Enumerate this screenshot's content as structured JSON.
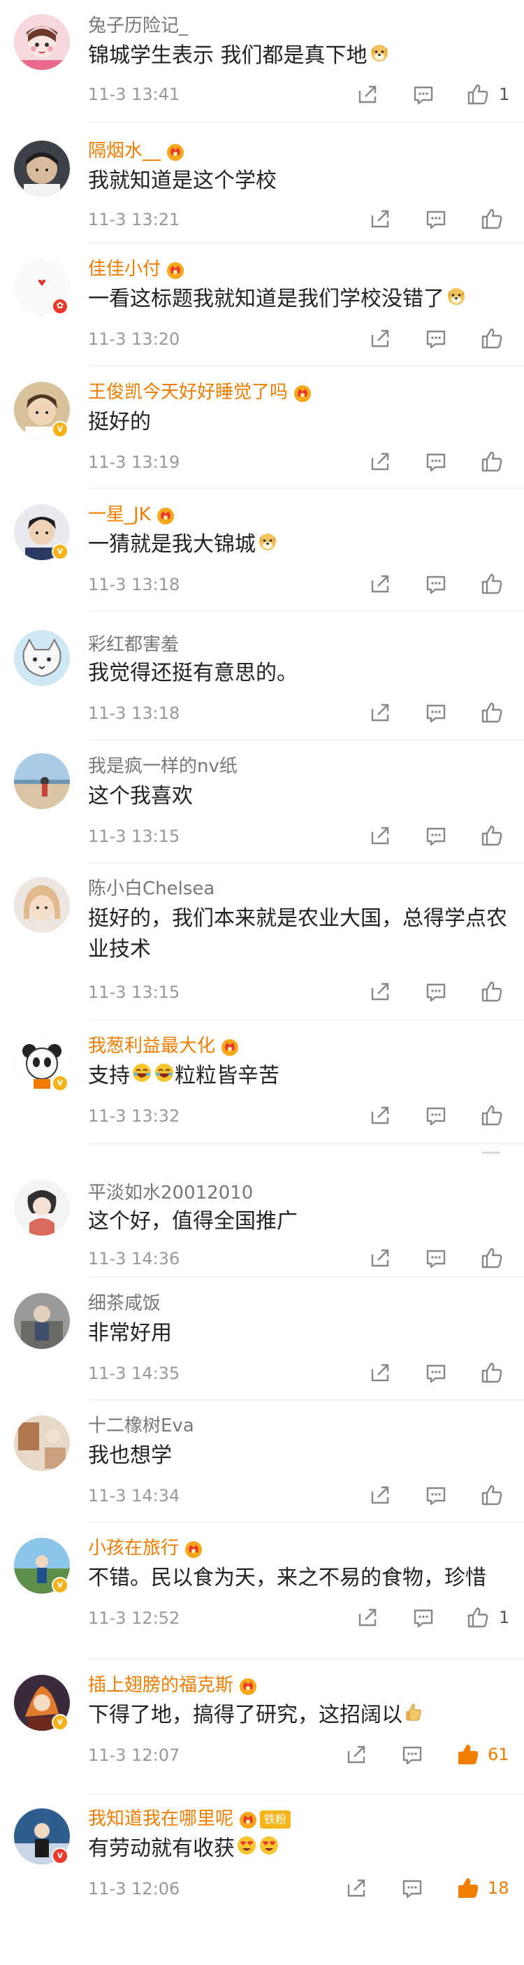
{
  "comments": [
    {
      "user": "兔子历险记_",
      "text": "锦城学生表示 我们都是真下地",
      "emoji": "doge",
      "time": "11-3 13:41",
      "likes": "1"
    },
    {
      "user": "隔烟水__",
      "text": "我就知道是这个学校",
      "time": "11-3 13:21",
      "likes": ""
    },
    {
      "user": "佳佳小付",
      "text": "一看这标题我就知道是我们学校没错了",
      "emoji": "doge",
      "time": "11-3 13:20",
      "likes": ""
    },
    {
      "user": "王俊凯今天好好睡觉了吗",
      "text": "挺好的",
      "time": "11-3 13:19",
      "likes": ""
    },
    {
      "user": "一星_JK",
      "text": "一猜就是我大锦城",
      "emoji": "doge",
      "time": "11-3 13:18",
      "likes": ""
    },
    {
      "user": "彩红都害羞",
      "text": "我觉得还挺有意思的。",
      "time": "11-3 13:18",
      "likes": ""
    },
    {
      "user": "我是疯一样的nv纸",
      "text": "这个我喜欢",
      "time": "11-3 13:15",
      "likes": ""
    },
    {
      "user": "陈小白Chelsea",
      "text": "挺好的，我们本来就是农业大国，总得学点农业技术",
      "time": "11-3 13:15",
      "likes": ""
    },
    {
      "user": "我葱利益最大化",
      "text": "支持",
      "text2": "粒粒皆辛苦",
      "time": "11-3 13:32",
      "likes": ""
    },
    {
      "user": "平淡如水20012010",
      "text": "这个好，值得全国推广",
      "time": "11-3 14:36",
      "likes": ""
    },
    {
      "user": "细茶咸饭",
      "text": "非常好用",
      "time": "11-3 14:35",
      "likes": ""
    },
    {
      "user": "十二橡树Eva",
      "text": "我也想学",
      "time": "11-3 14:34",
      "likes": ""
    },
    {
      "user": "小孩在旅行",
      "text": "不错。民以食为天，来之不易的食物，珍惜",
      "time": "11-3 12:52",
      "likes": "1"
    },
    {
      "user": "插上翅膀的福克斯",
      "text": "下得了地，搞得了研究，这招阔以",
      "emoji": "thumb",
      "time": "11-3 12:07",
      "likes": "61"
    },
    {
      "user": "我知道我在哪里呢",
      "fan_tag": "铁粉",
      "text": "有劳动就有收获",
      "time": "11-3 12:06",
      "likes": "18"
    }
  ],
  "colors": {
    "vip_name": "#f07d00",
    "name": "#777777",
    "text": "#222222",
    "time": "#999999",
    "liked": "#f07d00"
  },
  "icons": [
    "share-icon",
    "comment-icon",
    "like-icon",
    "crown-icon",
    "doge-emoji",
    "laugh-emoji",
    "heart-eyes-emoji",
    "verified-badge"
  ]
}
